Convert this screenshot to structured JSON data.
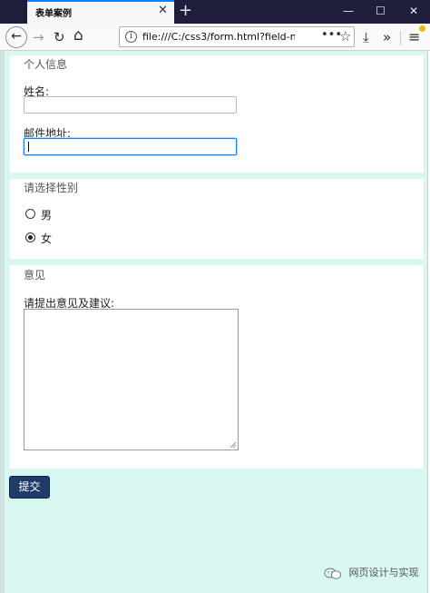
{
  "browser": {
    "tab_title": "表单案例",
    "tab_close": "✕",
    "new_tab": "+",
    "window_controls": {
      "minimize": "—",
      "maximize": "☐",
      "close": "✕"
    },
    "nav": {
      "back": "←",
      "forward": "→",
      "reload": "↻",
      "home": "⌂"
    },
    "url": "file:///C:/css3/form.html?field-name",
    "url_actions": {
      "more": "•••",
      "bookmark": "☆"
    },
    "toolbar": {
      "download": "⤓",
      "overflow": "»",
      "menu": "≡"
    }
  },
  "form": {
    "personal": {
      "legend": "个人信息",
      "name_label": "姓名:",
      "name_value": "",
      "email_label": "邮件地址:",
      "email_value": ""
    },
    "gender": {
      "legend": "请选择性别",
      "options": [
        {
          "label": "男",
          "selected": false
        },
        {
          "label": "女",
          "selected": true
        }
      ]
    },
    "opinion": {
      "legend": "意见",
      "label": "请提出意见及建议:",
      "value": ""
    },
    "submit_label": "提交"
  },
  "watermark": "网页设计与实现",
  "colors": {
    "page_background": "#d9f7f1",
    "submit_button": "#1f3d68",
    "focus_ring": "#0a84ff",
    "title_bar": "#1e1e3c"
  }
}
